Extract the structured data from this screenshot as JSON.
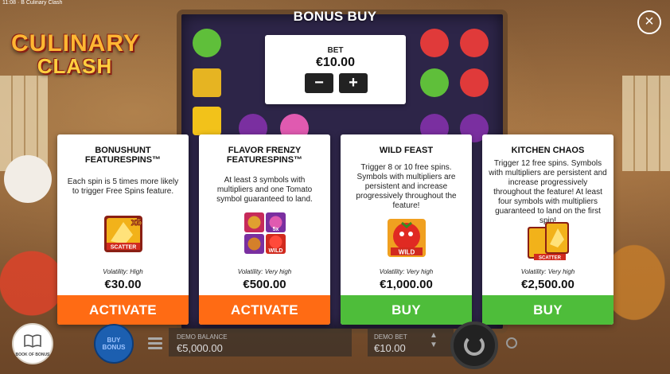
{
  "status": {
    "time_title": "11:08 · B Culinary Clash"
  },
  "game": {
    "logo_line1": "CULINARY",
    "logo_line2": "CLASH"
  },
  "modal": {
    "title": "BONUS BUY",
    "close_icon": "close-icon",
    "bet": {
      "label": "BET",
      "value": "€10.00",
      "minus": "−",
      "plus": "+"
    }
  },
  "cards": [
    {
      "title": "BONUSHUNT FEATURESPINS™",
      "description": "Each spin is 5 times more likely to trigger Free Spins feature.",
      "image": "scatter-x5-icon",
      "volatility": "Volatility: High",
      "price": "€30.00",
      "action": "ACTIVATE",
      "action_color": "#ff6b14"
    },
    {
      "title": "FLAVOR FRENZY FEATURESPINS™",
      "description": "At least 3 symbols with multipliers and one Tomato symbol guaranteed to land.",
      "image": "multiplier-symbols-icon",
      "volatility": "Volatility: Very high",
      "price": "€500.00",
      "action": "ACTIVATE",
      "action_color": "#ff6b14"
    },
    {
      "title": "WILD FEAST",
      "description": "Trigger 8 or 10 free spins. Symbols with multipliers are persistent and increase progressively throughout the feature!",
      "image": "tomato-wild-icon",
      "volatility": "Volatility: Very high",
      "price": "€1,000.00",
      "action": "BUY",
      "action_color": "#4ebd3a"
    },
    {
      "title": "KITCHEN CHAOS",
      "description": "Trigger 12 free spins. Symbols with multipliers are persistent and increase progressively throughout the feature! At least four symbols with multipliers guaranteed to land on the first spin!",
      "image": "scatter-stack-icon",
      "volatility": "Volatility: Very high",
      "price": "€2,500.00",
      "action": "BUY",
      "action_color": "#4ebd3a"
    }
  ],
  "bottom": {
    "book_label": "BOOK OF BONUS",
    "buy_bonus": "BUY BONUS",
    "balance_label": "DEMO BALANCE",
    "balance_value": "€5,000.00",
    "bet_label": "DEMO BET",
    "bet_value": "€10.00"
  }
}
